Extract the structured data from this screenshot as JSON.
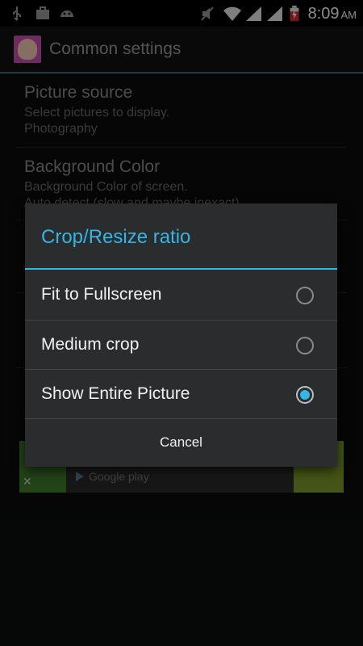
{
  "status_bar": {
    "time": "8:09",
    "ampm": "AM",
    "icons": [
      "usb-icon",
      "briefcase-icon",
      "android-icon",
      "mute-icon",
      "wifi-icon",
      "signal-icon",
      "signal-icon",
      "battery-charging-icon"
    ]
  },
  "action_bar": {
    "title": "Common settings"
  },
  "preferences": [
    {
      "title": "Picture source",
      "summary": "Select pictures to display.",
      "value": "Photography"
    },
    {
      "title": "Background Color",
      "summary": "Background Color of screen.",
      "value": "Auto detect (slow and maybe inexact)"
    }
  ],
  "ad": {
    "store_label": "Google play",
    "close": "✕"
  },
  "dialog": {
    "title": "Crop/Resize ratio",
    "options": [
      {
        "label": "Fit to Fullscreen",
        "checked": false
      },
      {
        "label": "Medium crop",
        "checked": false
      },
      {
        "label": "Show Entire Picture",
        "checked": true
      }
    ],
    "cancel_label": "Cancel"
  },
  "colors": {
    "accent": "#33b5e5",
    "dialog_bg": "#2b2c2e",
    "statusbar_bg": "#000000"
  }
}
